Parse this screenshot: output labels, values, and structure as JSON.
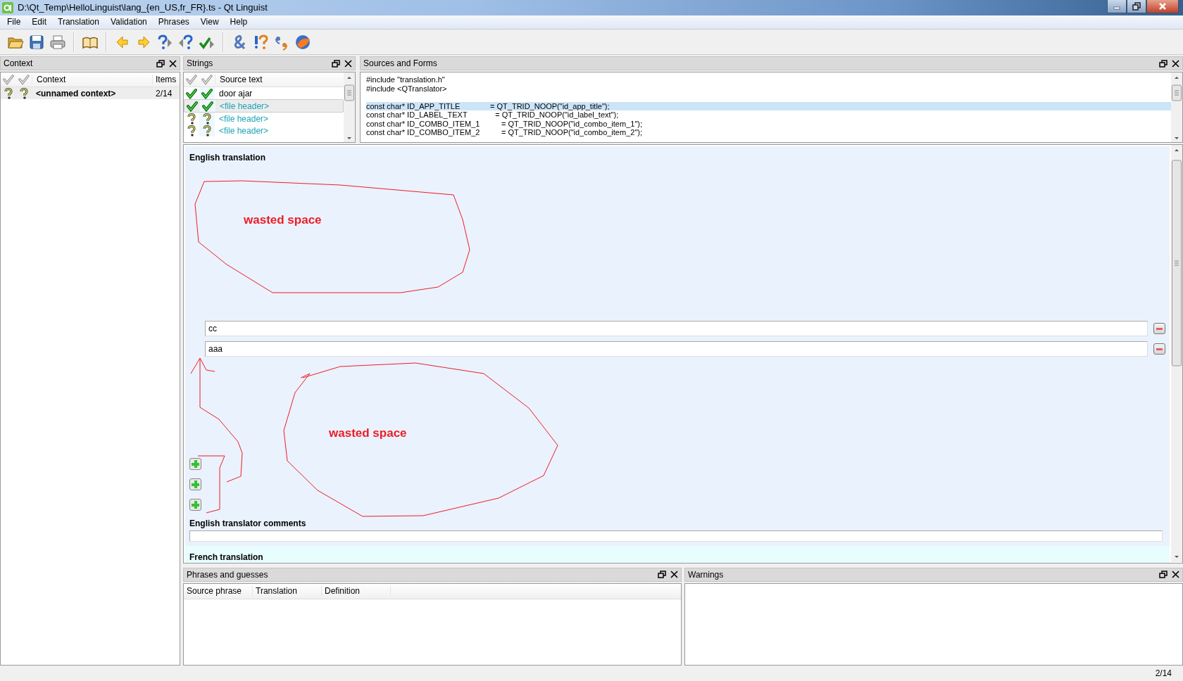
{
  "window": {
    "title": "D:\\Qt_Temp\\HelloLinguist\\lang_{en_US,fr_FR}.ts - Qt Linguist"
  },
  "menu": [
    "File",
    "Edit",
    "Translation",
    "Validation",
    "Phrases",
    "View",
    "Help"
  ],
  "context_panel": {
    "title": "Context",
    "columns": [
      "Context",
      "Items"
    ],
    "rows": [
      {
        "name": "<unnamed context>",
        "items": "2/14",
        "finished": false,
        "selected": true
      }
    ]
  },
  "strings_panel": {
    "title": "Strings",
    "columns": [
      "Source text"
    ],
    "rows": [
      {
        "text": "door ajar",
        "kind": "message",
        "finished": true,
        "selected": false
      },
      {
        "text": "<file header>",
        "kind": "file_header",
        "finished": true,
        "selected": true
      },
      {
        "text": "<file header>",
        "kind": "file_header",
        "finished": false,
        "selected": false
      },
      {
        "text": "<file header>",
        "kind": "file_header",
        "finished": false,
        "selected": false
      }
    ]
  },
  "sources_panel": {
    "title": "Sources and Forms",
    "blocks": [
      {
        "lines": [
          {
            "text": "#include \"translation.h\"",
            "selected": false
          },
          {
            "text": "#include <QTranslator>",
            "selected": false
          }
        ]
      },
      {
        "lines": [
          {
            "text": "const char* ID_APP_TITLE              = QT_TRID_NOOP(\"id_app_title\");",
            "selected": true
          },
          {
            "text": "const char* ID_LABEL_TEXT             = QT_TRID_NOOP(\"id_label_text\");",
            "selected": false
          },
          {
            "text": "const char* ID_COMBO_ITEM_1          = QT_TRID_NOOP(\"id_combo_item_1\");",
            "selected": false
          },
          {
            "text": "const char* ID_COMBO_ITEM_2          = QT_TRID_NOOP(\"id_combo_item_2\");",
            "selected": false
          }
        ]
      }
    ]
  },
  "editor": {
    "sections": [
      {
        "heading": "English translation",
        "kind": "translation",
        "color": "#eaf2fd",
        "forms": [
          {
            "kind": "filled",
            "value": "cc"
          },
          {
            "kind": "filled",
            "value": "aaa"
          },
          {
            "kind": "unused"
          },
          {
            "kind": "unused"
          },
          {
            "kind": "unused"
          }
        ]
      },
      {
        "heading": "English translator comments",
        "kind": "comment",
        "color": "#eaf2fd"
      },
      {
        "heading": "French translation",
        "kind": "heading_only",
        "color": "#e8fdfd"
      }
    ],
    "annotations": [
      {
        "text": "wasted space"
      },
      {
        "text": "wasted space"
      }
    ]
  },
  "phrases_panel": {
    "title": "Phrases and guesses",
    "columns": [
      "Source phrase",
      "Translation",
      "Definition"
    ]
  },
  "warnings_panel": {
    "title": "Warnings"
  },
  "status_bar": {
    "text": "2/14"
  }
}
